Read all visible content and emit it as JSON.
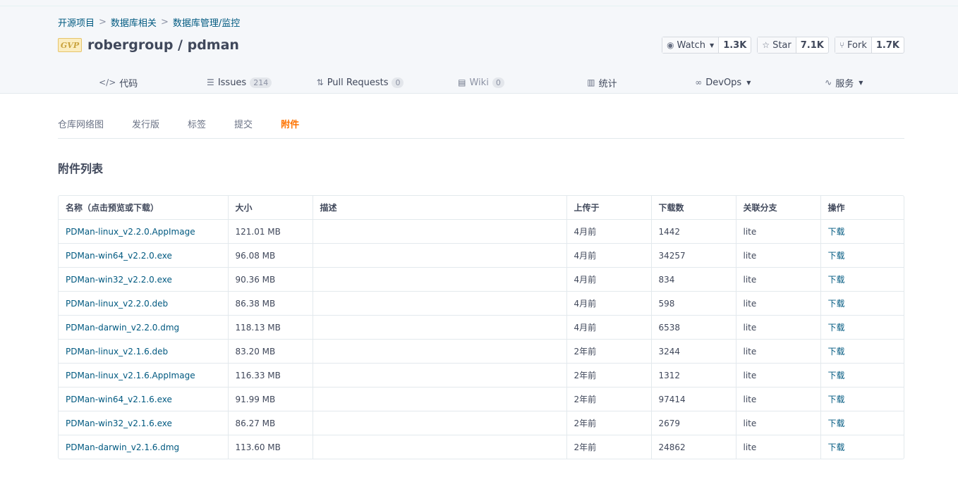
{
  "breadcrumb": {
    "items": [
      "开源项目",
      "数据库相关",
      "数据库管理/监控"
    ],
    "separator": ">"
  },
  "repo": {
    "badge": "GVP",
    "title": "robergroup / pdman"
  },
  "social": {
    "watch": {
      "label": "Watch",
      "count": "1.3K"
    },
    "star": {
      "label": "Star",
      "count": "7.1K"
    },
    "fork": {
      "label": "Fork",
      "count": "1.7K"
    }
  },
  "nav": [
    {
      "label": "代码",
      "icon": "code-icon"
    },
    {
      "label": "Issues",
      "badge": "214",
      "icon": "issues-icon"
    },
    {
      "label": "Pull Requests",
      "badge": "0",
      "icon": "pull-request-icon"
    },
    {
      "label": "Wiki",
      "badge": "0",
      "icon": "wiki-icon"
    },
    {
      "label": "统计",
      "icon": "stats-icon"
    },
    {
      "label": "DevOps",
      "icon": "infinity-icon"
    },
    {
      "label": "服务",
      "icon": "pulse-icon"
    }
  ],
  "subtabs": [
    "仓库网络图",
    "发行版",
    "标签",
    "提交",
    "附件"
  ],
  "active_subtab": "附件",
  "section_title": "附件列表",
  "table": {
    "headers": [
      "名称（点击预览或下载）",
      "大小",
      "描述",
      "上传于",
      "下载数",
      "关联分支",
      "操作"
    ],
    "rows": [
      {
        "name": "PDMan-linux_v2.2.0.AppImage",
        "size": "121.01 MB",
        "desc": "",
        "uploaded": "4月前",
        "downloads": "1442",
        "branch": "lite",
        "action": "下载"
      },
      {
        "name": "PDMan-win64_v2.2.0.exe",
        "size": "96.08 MB",
        "desc": "",
        "uploaded": "4月前",
        "downloads": "34257",
        "branch": "lite",
        "action": "下载"
      },
      {
        "name": "PDMan-win32_v2.2.0.exe",
        "size": "90.36 MB",
        "desc": "",
        "uploaded": "4月前",
        "downloads": "834",
        "branch": "lite",
        "action": "下载"
      },
      {
        "name": "PDMan-linux_v2.2.0.deb",
        "size": "86.38 MB",
        "desc": "",
        "uploaded": "4月前",
        "downloads": "598",
        "branch": "lite",
        "action": "下载"
      },
      {
        "name": "PDMan-darwin_v2.2.0.dmg",
        "size": "118.13 MB",
        "desc": "",
        "uploaded": "4月前",
        "downloads": "6538",
        "branch": "lite",
        "action": "下载"
      },
      {
        "name": "PDMan-linux_v2.1.6.deb",
        "size": "83.20 MB",
        "desc": "",
        "uploaded": "2年前",
        "downloads": "3244",
        "branch": "lite",
        "action": "下载"
      },
      {
        "name": "PDMan-linux_v2.1.6.AppImage",
        "size": "116.33 MB",
        "desc": "",
        "uploaded": "2年前",
        "downloads": "1312",
        "branch": "lite",
        "action": "下载"
      },
      {
        "name": "PDMan-win64_v2.1.6.exe",
        "size": "91.99 MB",
        "desc": "",
        "uploaded": "2年前",
        "downloads": "97414",
        "branch": "lite",
        "action": "下载"
      },
      {
        "name": "PDMan-win32_v2.1.6.exe",
        "size": "86.27 MB",
        "desc": "",
        "uploaded": "2年前",
        "downloads": "2679",
        "branch": "lite",
        "action": "下载"
      },
      {
        "name": "PDMan-darwin_v2.1.6.dmg",
        "size": "113.60 MB",
        "desc": "",
        "uploaded": "2年前",
        "downloads": "24862",
        "branch": "lite",
        "action": "下载"
      }
    ]
  },
  "colors": {
    "link": "#005980",
    "active_tab": "#fe7300",
    "header_bg": "#f5f7fa"
  }
}
